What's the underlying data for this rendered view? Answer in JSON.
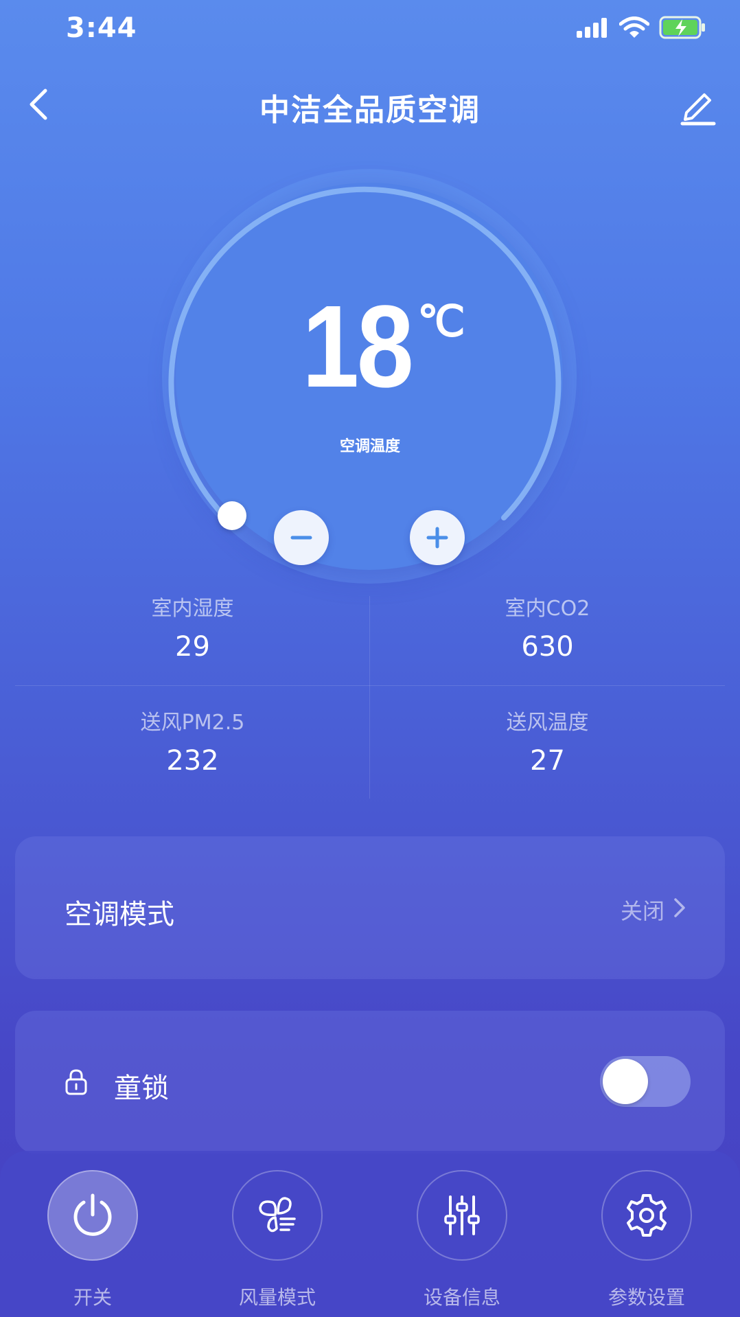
{
  "status_bar": {
    "time": "3:44"
  },
  "header": {
    "title": "中洁全品质空调"
  },
  "thermostat": {
    "temperature": "18",
    "unit": "℃",
    "label": "空调温度"
  },
  "stats": [
    {
      "label": "室内湿度",
      "value": "29"
    },
    {
      "label": "室内CO2",
      "value": "630"
    },
    {
      "label": "送风PM2.5",
      "value": "232"
    },
    {
      "label": "送风温度",
      "value": "27"
    }
  ],
  "mode": {
    "label": "空调模式",
    "status": "关闭"
  },
  "child_lock": {
    "label": "童锁",
    "enabled": false
  },
  "bottom_nav": [
    {
      "label": "开关",
      "icon": "power-icon",
      "active": true
    },
    {
      "label": "风量模式",
      "icon": "fan-icon",
      "active": false
    },
    {
      "label": "设备信息",
      "icon": "sliders-icon",
      "active": false
    },
    {
      "label": "参数设置",
      "icon": "gear-icon",
      "active": false
    }
  ],
  "colors": {
    "accent": "#4a8ee8",
    "background_top": "#5a8bed",
    "background_bottom": "#4640c0"
  }
}
